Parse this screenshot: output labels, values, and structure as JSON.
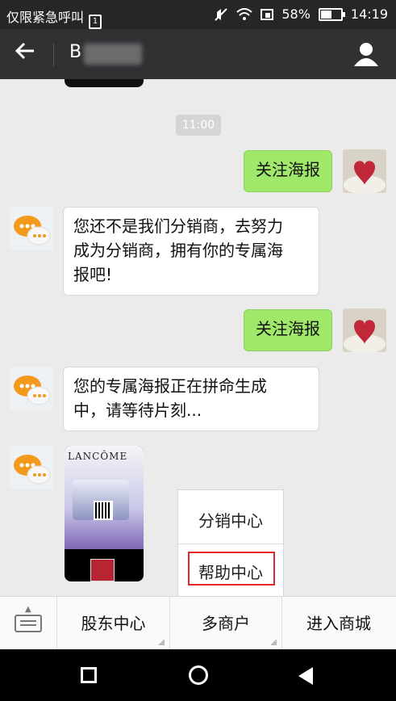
{
  "status_bar": {
    "carrier": "仅限紧急呼叫",
    "sim_indicator": "1",
    "battery_percent": "58%",
    "battery_level": 0.58,
    "time": "14:19",
    "icons": [
      "sim-icon",
      "mute-icon",
      "wifi-icon",
      "data-icon",
      "battery-icon"
    ]
  },
  "nav": {
    "title_visible": "B",
    "icons": {
      "back": "back-arrow-icon",
      "profile": "user-icon"
    }
  },
  "chat": {
    "timestamp": "11:00",
    "messages": [
      {
        "side": "right",
        "text": "关注海报"
      },
      {
        "side": "left",
        "text": "您还不是我们分销商，去努力\n成为分销商，拥有你的专属海\n报吧!"
      },
      {
        "side": "right",
        "text": "关注海报"
      },
      {
        "side": "left",
        "text": "您的专属海报正在拼命生成\n中，请等待片刻..."
      }
    ],
    "poster_brand": "LANCÔME"
  },
  "popup_menu": {
    "items": [
      {
        "label": "分销中心"
      },
      {
        "label": "帮助中心",
        "highlighted": true
      }
    ]
  },
  "bottom_menu": {
    "keyboard_icon": "keyboard-icon",
    "items": [
      {
        "label": "股东中心"
      },
      {
        "label": "多商户"
      },
      {
        "label": "进入商城"
      }
    ]
  },
  "system_nav": {
    "icons": [
      "recent-apps-icon",
      "home-icon",
      "back-icon"
    ]
  },
  "colors": {
    "green_bubble": "#9fe86a",
    "highlight_border": "#e0262c",
    "navbar": "#2f3133"
  }
}
